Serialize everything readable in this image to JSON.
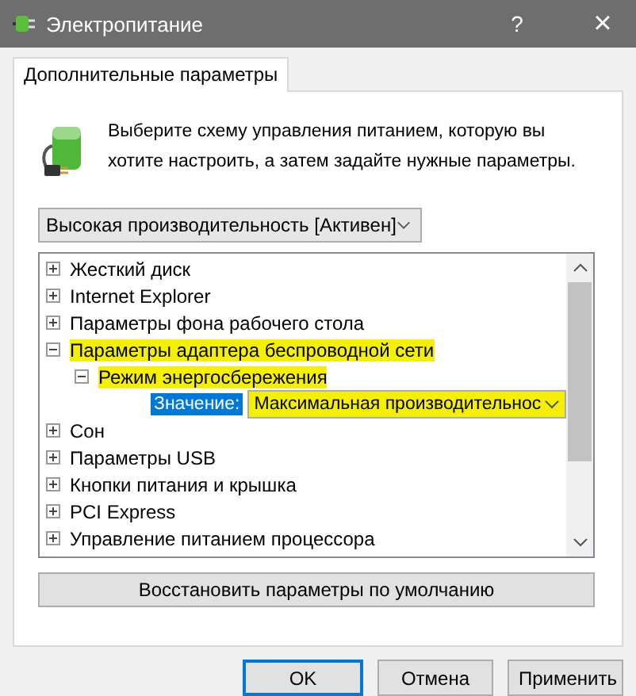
{
  "window": {
    "title": "Электропитание",
    "help": "?",
    "close": "×"
  },
  "tabs": [
    {
      "label": "Дополнительные параметры",
      "selected": true
    }
  ],
  "intro": "Выберите схему управления питанием, которую вы хотите настроить, а затем задайте нужные параметры.",
  "plan_dropdown": {
    "value": "Высокая производительность [Активен]"
  },
  "tree": [
    {
      "label": "Жесткий диск",
      "expanded": false,
      "highlighted": false
    },
    {
      "label": "Internet Explorer",
      "expanded": false,
      "highlighted": false
    },
    {
      "label": "Параметры фона рабочего стола",
      "expanded": false,
      "highlighted": false
    },
    {
      "label": "Параметры адаптера беспроводной сети",
      "expanded": true,
      "highlighted": true,
      "children": [
        {
          "label": "Режим энергосбережения",
          "expanded": true,
          "highlighted": true,
          "children": [
            {
              "kind": "setting",
              "label": "Значение:",
              "value": "Максимальная производительнос",
              "highlighted": true
            }
          ]
        }
      ]
    },
    {
      "label": "Сон",
      "expanded": false,
      "highlighted": false
    },
    {
      "label": "Параметры USB",
      "expanded": false,
      "highlighted": false
    },
    {
      "label": "Кнопки питания и крышка",
      "expanded": false,
      "highlighted": false
    },
    {
      "label": "PCI Express",
      "expanded": false,
      "highlighted": false
    },
    {
      "label": "Управление питанием процессора",
      "expanded": false,
      "highlighted": false
    }
  ],
  "restore_button": "Восстановить параметры по умолчанию",
  "buttons": [
    {
      "label": "OK",
      "default": true
    },
    {
      "label": "Отмена",
      "default": false
    },
    {
      "label": "Применить",
      "default": false
    }
  ]
}
